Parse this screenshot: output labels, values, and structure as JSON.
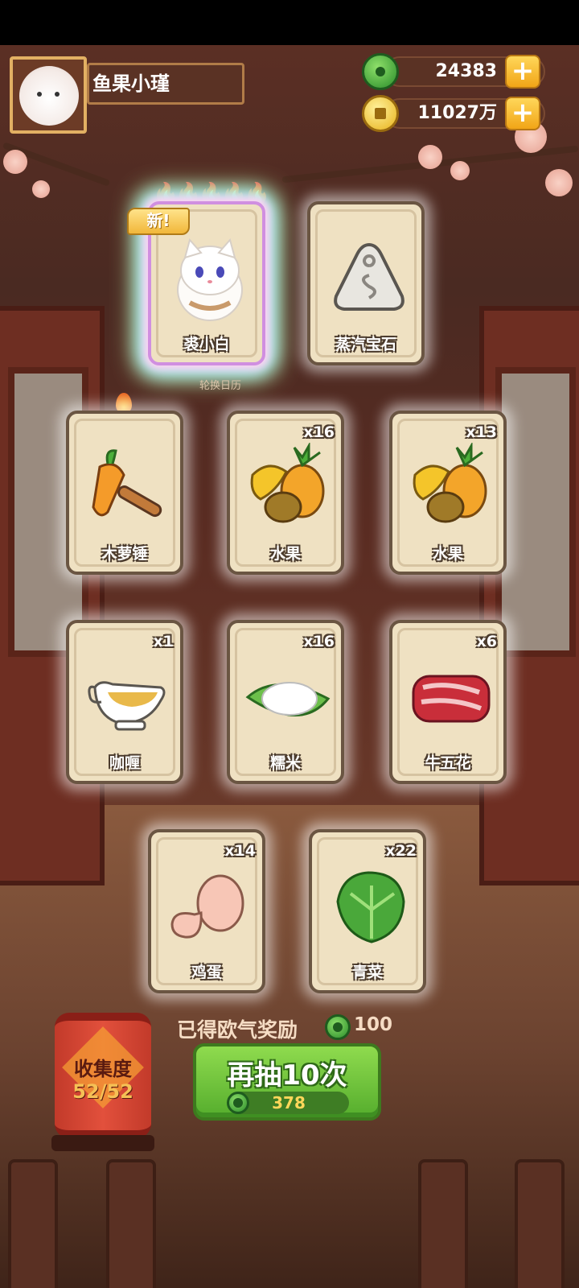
{
  "player": {
    "name": "鱼果小瑾"
  },
  "currency": {
    "jade": {
      "value": "24383",
      "icon": "jade-icon"
    },
    "coin": {
      "value": "11027万",
      "icon": "coin-icon"
    },
    "add_label": "+"
  },
  "featured_cards": [
    {
      "label": "裘小白",
      "badge": "新!",
      "rarity_flames": "🔥🔥🔥🔥🔥",
      "art": "white-cat-character"
    },
    {
      "label": "蒸汽宝石",
      "art": "steam-gem-stone"
    }
  ],
  "calendar_label": "轮换日历",
  "cards": [
    {
      "label": "木萝锤",
      "qty": "",
      "art": "carrot-hammer"
    },
    {
      "label": "水果",
      "qty": "x16",
      "art": "fruit"
    },
    {
      "label": "水果",
      "qty": "x13",
      "art": "fruit"
    },
    {
      "label": "咖喱",
      "qty": "x1",
      "art": "curry-gravy-boat"
    },
    {
      "label": "糯米",
      "qty": "x16",
      "art": "sticky-rice-leaf"
    },
    {
      "label": "牛五花",
      "qty": "x6",
      "art": "beef-belly"
    },
    {
      "label": "鸡蛋",
      "qty": "x14",
      "art": "eggs"
    },
    {
      "label": "青菜",
      "qty": "x22",
      "art": "green-vegetable"
    }
  ],
  "lucky_reward": {
    "label": "已得欧气奖励",
    "value": "100"
  },
  "draw_button": {
    "label": "再抽10次",
    "cost": "378"
  },
  "collection": {
    "label": "收集度",
    "count": "52/52"
  }
}
